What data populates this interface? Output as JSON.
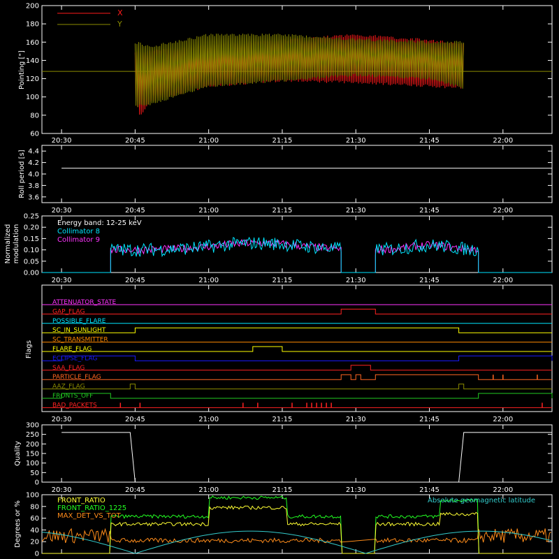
{
  "time_ticks": [
    "20:30",
    "20:45",
    "21:00",
    "21:15",
    "21:30",
    "21:45",
    "22:00"
  ],
  "chart_data": [
    {
      "type": "line",
      "ylabel": "Pointing [\"]",
      "ylim": [
        60,
        200
      ],
      "yticks": [
        "60",
        "80",
        "100",
        "120",
        "140",
        "160",
        "180",
        "200"
      ],
      "legend": "top-left",
      "series": [
        {
          "name": "X",
          "color": "#ff1a1a",
          "x": [
            "20:45",
            "20:46",
            "20:48",
            "21:00",
            "21:15",
            "21:30",
            "21:45",
            "21:52"
          ],
          "upper": [
            150,
            148,
            150,
            156,
            162,
            168,
            162,
            158
          ],
          "lower": [
            100,
            78,
            95,
            112,
            118,
            116,
            112,
            110
          ]
        },
        {
          "name": "Y",
          "color": "#8c8c00",
          "x": [
            "20:45",
            "20:48",
            "21:00",
            "21:15",
            "21:30",
            "21:45",
            "21:52"
          ],
          "upper": [
            160,
            155,
            168,
            168,
            163,
            160,
            160
          ],
          "lower": [
            90,
            92,
            112,
            118,
            124,
            120,
            110
          ],
          "baseline": 128
        }
      ]
    },
    {
      "type": "line",
      "ylabel": "Roll period [s]",
      "ylim": [
        3.5,
        4.5
      ],
      "yticks": [
        "3.6",
        "3.8",
        "4.0",
        "4.2",
        "4.4"
      ],
      "series": [
        {
          "color": "#ffffff",
          "x": [
            "20:30",
            "22:10"
          ],
          "y": [
            4.1,
            4.1
          ]
        }
      ]
    },
    {
      "type": "line",
      "ylabel": "Normalized modulation",
      "ylim": [
        0,
        0.25
      ],
      "yticks": [
        "0.00",
        "0.05",
        "0.10",
        "0.15",
        "0.20",
        "0.25"
      ],
      "annotation": "Energy band: 12-25 keV",
      "series": [
        {
          "name": "Collimator 8",
          "color": "#00e5ff"
        },
        {
          "name": "Collimator 9",
          "color": "#ff33ff"
        }
      ],
      "segments": [
        [
          "20:40",
          "21:27"
        ],
        [
          "21:34",
          "21:55"
        ]
      ],
      "level": 0.1
    },
    {
      "type": "line",
      "ylabel": "Flags",
      "series": [
        {
          "name": "ATTENUATOR_STATE",
          "color": "#ff33ff",
          "states": []
        },
        {
          "name": "GAP_FLAG",
          "color": "#ff2222",
          "states": [
            [
              "21:27",
              "21:34"
            ]
          ]
        },
        {
          "name": "POSSIBLE_FLARE",
          "color": "#00e5ff",
          "states": []
        },
        {
          "name": "SC_IN_SUNLIGHT",
          "color": "#ffff00",
          "states": [
            [
              "20:45",
              "21:51"
            ]
          ]
        },
        {
          "name": "SC_TRANSMITTER",
          "color": "#ff8800",
          "states": []
        },
        {
          "name": "FLARE_FLAG",
          "color": "#ffff00",
          "states": [
            [
              "21:09",
              "21:15"
            ]
          ]
        },
        {
          "name": "ECLIPSE_FLAG",
          "color": "#1a1aff",
          "states": [
            [
              "20:30",
              "20:45"
            ],
            [
              "21:51",
              "22:10"
            ]
          ]
        },
        {
          "name": "SAA_FLAG",
          "color": "#ff2222",
          "states": [
            [
              "21:29",
              "21:33"
            ]
          ]
        },
        {
          "name": "PARTICLE_FLAG",
          "color": "#ff6622",
          "states": [
            [
              "21:27",
              "21:29"
            ],
            [
              "21:30",
              "21:31"
            ],
            [
              "21:34",
              "21:55"
            ]
          ]
        },
        {
          "name": "AAZ_FLAG",
          "color": "#8c8c00",
          "states": [
            [
              "20:44",
              "20:45"
            ],
            [
              "21:51",
              "21:52"
            ]
          ]
        },
        {
          "name": "FRONTS_OFF",
          "color": "#22cc22",
          "states": [
            [
              "20:30",
              "20:40"
            ],
            [
              "21:55",
              "22:10"
            ]
          ]
        },
        {
          "name": "BAD_PACKETS",
          "color": "#ff2222",
          "states": []
        }
      ]
    },
    {
      "type": "line",
      "ylabel": "Quality",
      "ylim": [
        0,
        300
      ],
      "yticks": [
        "0",
        "50",
        "100",
        "150",
        "200",
        "250",
        "300"
      ],
      "series": [
        {
          "color": "#ffffff",
          "x": [
            "20:30",
            "20:44",
            "20:45",
            "21:51",
            "21:52",
            "22:10"
          ],
          "y": [
            260,
            260,
            0,
            0,
            260,
            260
          ]
        }
      ]
    },
    {
      "type": "line",
      "ylabel": "Degrees or %",
      "ylim": [
        0,
        100
      ],
      "yticks": [
        "0",
        "20",
        "40",
        "60",
        "80",
        "100"
      ],
      "series": [
        {
          "name": "FRONT_RATIO",
          "color": "#ffff33"
        },
        {
          "name": "FRONT_RATIO_1225",
          "color": "#22ff22"
        },
        {
          "name": "MAX_DET_VS_TOT",
          "color": "#ff8c1a"
        },
        {
          "name": "Absolute geomagnetic latitude",
          "color": "#33cccc"
        }
      ]
    }
  ]
}
